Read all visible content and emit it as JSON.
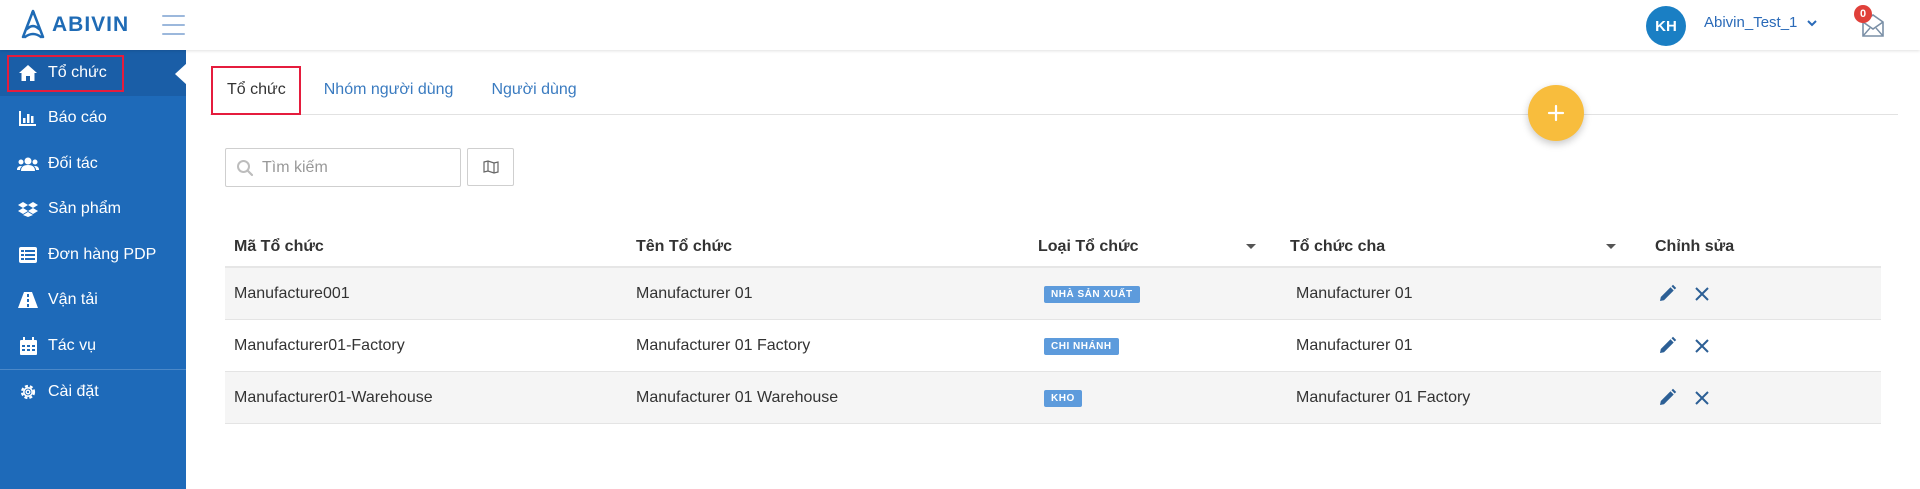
{
  "header": {
    "brand": "ABIVIN",
    "avatar_initials": "KH",
    "username": "Abivin_Test_1",
    "notification_count": "0",
    "accent": "#1e6ab9"
  },
  "sidebar": {
    "items": [
      {
        "label": "Tổ chức",
        "icon": "home-icon",
        "active": true
      },
      {
        "label": "Báo cáo",
        "icon": "bar-chart-icon"
      },
      {
        "label": "Đối tác",
        "icon": "users-icon"
      },
      {
        "label": "Sản phẩm",
        "icon": "dropbox-icon"
      },
      {
        "label": "Đơn hàng PDP",
        "icon": "list-icon"
      },
      {
        "label": "Vận tải",
        "icon": "road-icon"
      },
      {
        "label": "Tác vụ",
        "icon": "calendar-icon"
      },
      {
        "label": "Cài đặt",
        "icon": "gear-icon"
      }
    ]
  },
  "tabs": [
    {
      "label": "Tổ chức",
      "active": true
    },
    {
      "label": "Nhóm người dùng"
    },
    {
      "label": "Người dùng"
    }
  ],
  "search": {
    "placeholder": "Tìm kiếm",
    "value": ""
  },
  "table": {
    "headers": {
      "code": "Mã Tổ chức",
      "name": "Tên Tổ chức",
      "type": "Loại Tổ chức",
      "parent": "Tổ chức cha",
      "edit": "Chỉnh sửa"
    },
    "rows": [
      {
        "code": "Manufacture001",
        "name": "Manufacturer 01",
        "type": "NHÀ SẢN XUẤT",
        "parent": "Manufacturer 01"
      },
      {
        "code": "Manufacturer01-Factory",
        "name": "Manufacturer 01 Factory",
        "type": "CHI NHÁNH",
        "parent": "Manufacturer 01"
      },
      {
        "code": "Manufacturer01-Warehouse",
        "name": "Manufacturer 01 Warehouse",
        "type": "KHO",
        "parent": "Manufacturer 01 Factory"
      }
    ]
  }
}
